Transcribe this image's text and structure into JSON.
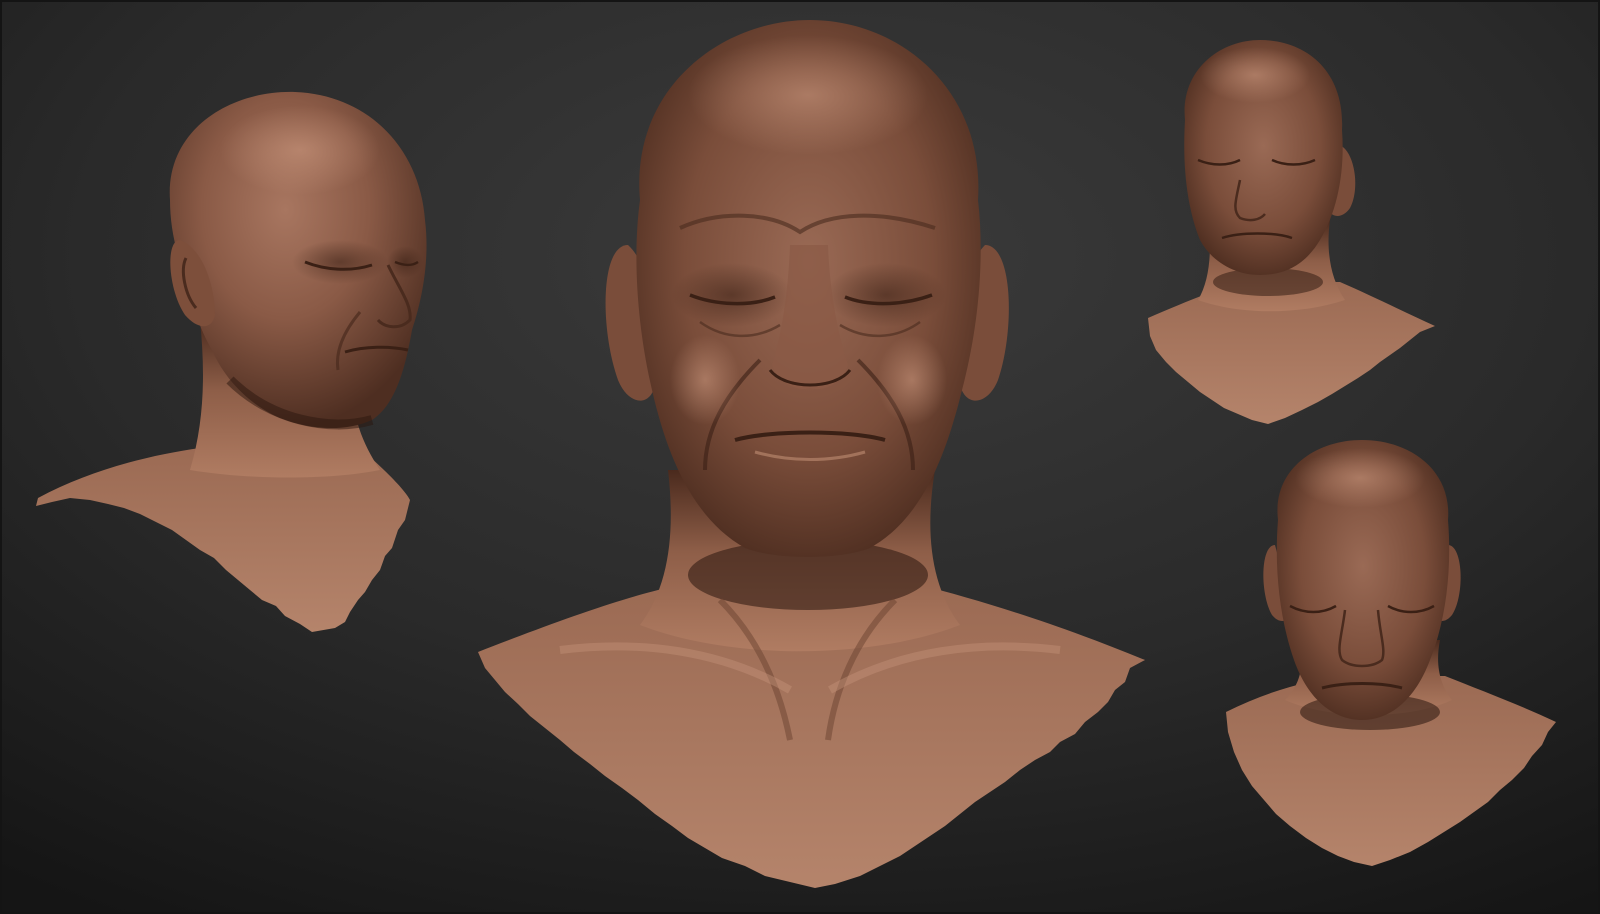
{
  "scene": {
    "subject": "sculpted-bust",
    "views": [
      {
        "id": "three-quarter-right",
        "label": ""
      },
      {
        "id": "front",
        "label": ""
      },
      {
        "id": "three-quarter-left-high",
        "label": ""
      },
      {
        "id": "front-low",
        "label": ""
      }
    ],
    "colors": {
      "background_light": "#3a3a3a",
      "background_dark": "#161616",
      "skin_light": "#b8836a",
      "skin_mid": "#8a5a46",
      "skin_dark": "#3e2419",
      "skin_shadow": "#24130d"
    }
  }
}
